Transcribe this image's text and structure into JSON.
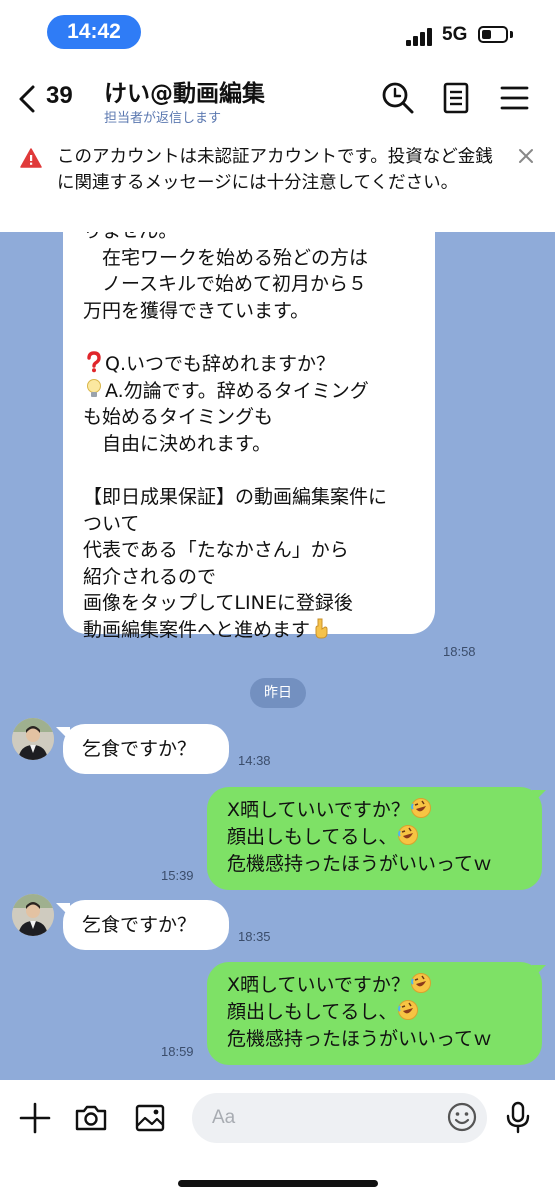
{
  "status_bar": {
    "time": "14:42",
    "network": "5G"
  },
  "header": {
    "back_count": "39",
    "title": "けい@動画編集",
    "subtitle": "担当者が返信します"
  },
  "banner": {
    "text": "このアカウントは未認証アカウントです。投資など金銭に関連するメッセージには十分注意してください。"
  },
  "chat": {
    "long_message": {
      "lines": [
        "りません。",
        "　在宅ワークを始める殆どの方は",
        "　ノースキルで始めて初月から５",
        "万円を獲得できています。",
        "",
        "Q.いつでも辞めれますか？",
        "A.勿論です。辞めるタイミング",
        "も始めるタイミングも",
        "　自由に決めれます。",
        "",
        "【即日成果保証】の動画編集案件に",
        "ついて",
        "代表である「たなかさん」から",
        "紹介されるので",
        "画像をタップしてLINEに登録後",
        "動画編集案件へと進めます"
      ],
      "time": "18:58"
    },
    "date_chip": "昨日",
    "messages": [
      {
        "side": "left",
        "text": "乞食ですか？",
        "time": "14:38"
      },
      {
        "side": "right",
        "lines": [
          "X晒していいですか？",
          "顔出しもしてるし、",
          "危機感持ったほうがいいってｗ"
        ],
        "time": "15:39"
      },
      {
        "side": "left",
        "text": "乞食ですか？",
        "time": "18:35"
      },
      {
        "side": "right",
        "lines": [
          "X晒していいですか？",
          "顔出しもしてるし、",
          "危機感持ったほうがいいってｗ"
        ],
        "time": "18:59"
      }
    ]
  },
  "input_bar": {
    "placeholder": "Aa"
  },
  "icons": {
    "back": "chevron-left-icon",
    "search": "search-icon",
    "notes": "notes-icon",
    "menu": "hamburger-menu-icon",
    "warning": "warning-icon",
    "close": "close-icon",
    "add": "plus-icon",
    "camera": "camera-icon",
    "image": "image-icon",
    "emoji": "smiley-icon",
    "mic": "microphone-icon",
    "question": "red-question-mark-emoji",
    "bulb": "light-bulb-emoji",
    "point_down": "pointing-down-emoji",
    "laugh": "rolling-laughing-emoji"
  },
  "colors": {
    "accent_blue": "#2f7cf6",
    "chat_bg": "#8fabd9",
    "my_bubble": "#7ee166",
    "warning_red": "#e03a3a"
  }
}
